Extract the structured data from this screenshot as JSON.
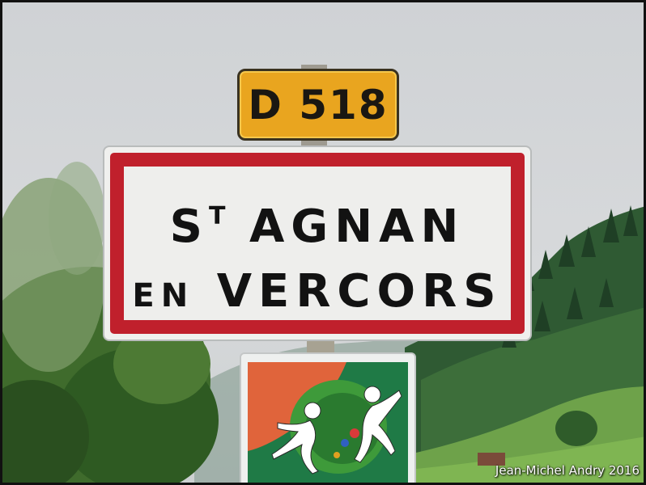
{
  "route_sign": {
    "text": "D 518",
    "color": "#e9a51f"
  },
  "place_sign": {
    "line1_prefix": "S",
    "line1_superscript": "T",
    "line1_rest": "AGNAN",
    "line2_prefix": "EN",
    "line2_rest": "VERCORS",
    "border_color": "#c0202c"
  },
  "credit": "Jean-Michel Andry 2016"
}
